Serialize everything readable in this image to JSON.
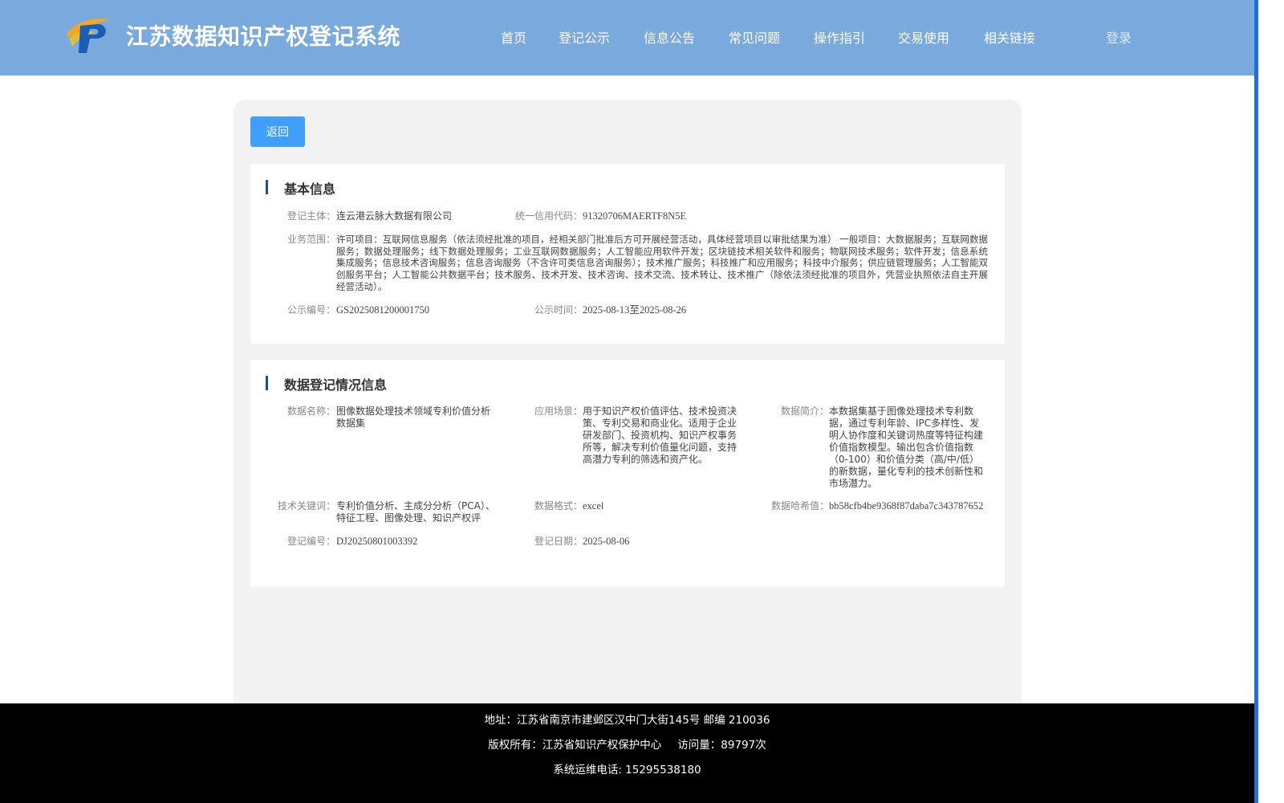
{
  "header": {
    "title": "江苏数据知识产权登记系统",
    "nav": [
      "首页",
      "登记公示",
      "信息公告",
      "常见问题",
      "操作指引",
      "交易使用",
      "相关链接"
    ],
    "login_label": "登录"
  },
  "actions": {
    "back_label": "返回"
  },
  "basic_info": {
    "title": "基本信息",
    "subject_label": "登记主体：",
    "subject_value": "连云港云脉大数据有限公司",
    "credit_code_label": "统一信用代码：",
    "credit_code_value": "91320706MAERTF8N5E",
    "scope_label": "业务范围：",
    "scope_value": "许可项目：互联网信息服务（依法须经批准的项目，经相关部门批准后方可开展经营活动，具体经营项目以审批结果为准） 一般项目：大数据服务；互联网数据服务；数据处理服务；线下数据处理服务；工业互联网数据服务；人工智能应用软件开发；区块链技术相关软件和服务；物联网技术服务；软件开发；信息系统集成服务；信息技术咨询服务；信息咨询服务（不含许可类信息咨询服务）；技术推广服务；科技推广和应用服务；科技中介服务；供应链管理服务；人工智能双创服务平台；人工智能公共数据平台；技术服务、技术开发、技术咨询、技术交流、技术转让、技术推广（除依法须经批准的项目外，凭营业执照依法自主开展经营活动）。",
    "pub_no_label": "公示编号：",
    "pub_no_value": "GS2025081200001750",
    "pub_time_label": "公示时间：",
    "pub_time_value": "2025-08-13至2025-08-26"
  },
  "data_info": {
    "title": "数据登记情况信息",
    "name_label": "数据名称：",
    "name_value": "图像数据处理技术领域专利价值分析数据集",
    "scenario_label": "应用场景：",
    "scenario_value": "用于知识产权价值评估、技术投资决策、专利交易和商业化。适用于企业研发部门、投资机构、知识产权事务所等，解决专利价值量化问题，支持高潜力专利的筛选和资产化。",
    "intro_label": "数据简介：",
    "intro_value": "本数据集基于图像处理技术专利数据，通过专利年龄、IPC多样性、发明人协作度和关键词热度等特征构建价值指数模型。输出包含价值指数（0-100）和价值分类（高/中/低）的新数据，量化专利的技术创新性和市场潜力。",
    "keywords_label": "技术关键词：",
    "keywords_value": "专利价值分析、主成分分析（PCA）、特征工程、图像处理、知识产权评",
    "format_label": "数据格式：",
    "format_value": "excel",
    "hash_label": "数据哈希值：",
    "hash_value": "bb58cfb4be9368f87daba7c343787652",
    "reg_no_label": "登记编号：",
    "reg_no_value": "DJ20250801003392",
    "reg_date_label": "登记日期：",
    "reg_date_value": "2025-08-06"
  },
  "footer": {
    "address": "地址：江苏省南京市建邺区汉中门大街145号 邮编 210036",
    "copyright": "版权所有：江苏省知识产权保护中心",
    "visits": "访问量：89797次",
    "phone": "系统运维电话: 15295538180"
  }
}
